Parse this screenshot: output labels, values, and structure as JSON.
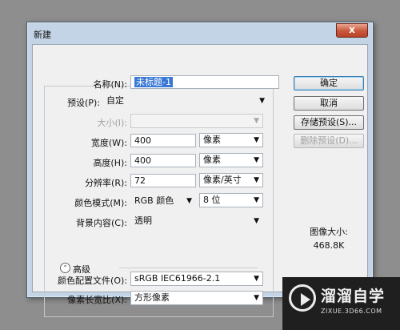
{
  "dialog": {
    "title": "新建",
    "close_glyph": "x"
  },
  "form": {
    "name_label": "名称(N):",
    "name_value": "未标题-1",
    "preset_label": "预设(P):",
    "preset_value": "自定",
    "size_label": "大小(I):",
    "size_value": "",
    "width_label": "宽度(W):",
    "width_value": "400",
    "width_unit": "像素",
    "height_label": "高度(H):",
    "height_value": "400",
    "height_unit": "像素",
    "resolution_label": "分辨率(R):",
    "resolution_value": "72",
    "resolution_unit": "像素/英寸",
    "color_mode_label": "颜色模式(M):",
    "color_mode_value": "RGB 颜色",
    "bit_depth_value": "8 位",
    "background_label": "背景内容(C):",
    "background_value": "透明",
    "advanced_label": "高级",
    "color_profile_label": "颜色配置文件(O):",
    "color_profile_value": "sRGB IEC61966-2.1",
    "pixel_aspect_label": "像素长宽比(X):",
    "pixel_aspect_value": "方形像素"
  },
  "buttons": {
    "ok": "确定",
    "cancel": "取消",
    "save_preset": "存储预设(S)...",
    "delete_preset": "删除预设(D)..."
  },
  "image_size": {
    "label": "图像大小:",
    "value": "468.8K"
  },
  "watermark": {
    "title": "溜溜自学",
    "subtitle": "ZIXUE.3D66.COM"
  }
}
